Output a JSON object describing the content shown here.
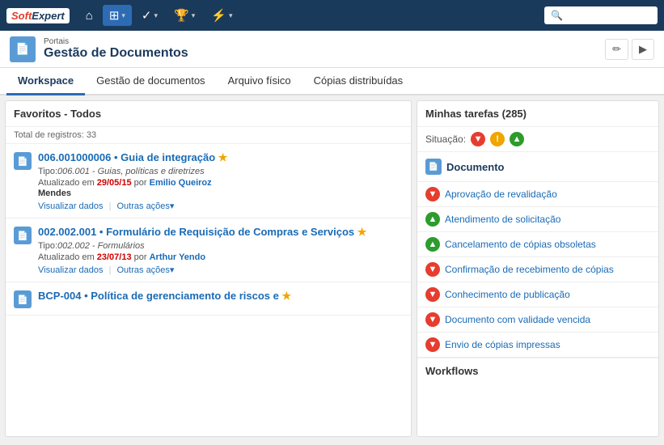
{
  "navbar": {
    "logo_soft": "Soft",
    "logo_expert": "Expert",
    "nav_items": [
      {
        "id": "home",
        "icon": "⌂",
        "label": "Home",
        "active": false
      },
      {
        "id": "apps",
        "icon": "⊞",
        "label": "Apps",
        "active": true,
        "has_chevron": true
      },
      {
        "id": "check",
        "icon": "✓",
        "label": "Check",
        "active": false,
        "has_chevron": true
      },
      {
        "id": "trophy",
        "icon": "🏆",
        "label": "Trophy",
        "active": false,
        "has_chevron": true
      },
      {
        "id": "lightning",
        "icon": "⚡",
        "label": "Lightning",
        "active": false,
        "has_chevron": true
      }
    ],
    "search_placeholder": "🔍"
  },
  "page_header": {
    "portais_label": "Portais",
    "title": "Gestão de Documentos"
  },
  "tabs": [
    {
      "id": "workspace",
      "label": "Workspace",
      "active": true
    },
    {
      "id": "gestao",
      "label": "Gestão de documentos",
      "active": false
    },
    {
      "id": "arquivo",
      "label": "Arquivo físico",
      "active": false
    },
    {
      "id": "copias",
      "label": "Cópias distribuídas",
      "active": false
    }
  ],
  "left_panel": {
    "header": "Favoritos - Todos",
    "total_label": "Total de registros: 33",
    "documents": [
      {
        "id": "doc1",
        "code": "006.001000006 • Guia de integração ★",
        "title_text": "006.001000006 • Guia de integração",
        "has_star": true,
        "type_prefix": "Tipo:",
        "type_code": "006.001",
        "type_name": "Guias, políticas e diretrizes",
        "updated_prefix": "Atualizado em ",
        "updated_date": "29/05/15",
        "updated_by": " por ",
        "author1": "Emilio Queiroz",
        "author2": "Mendes",
        "view_label": "Visualizar dados",
        "actions_label": "Outras ações▾"
      },
      {
        "id": "doc2",
        "code": "002.002.001 • Formulário de Requisição de Compras e Serviços ★",
        "title_text": "002.002.001 • Formulário de Requisição de Compras e Serviços",
        "has_star": true,
        "type_prefix": "Tipo:",
        "type_code": "002.002",
        "type_name": "Formulários",
        "updated_prefix": "Atualizado em ",
        "updated_date": "23/07/13",
        "updated_by": " por ",
        "author1": "Arthur Yendo",
        "author2": "",
        "view_label": "Visualizar dados",
        "actions_label": "Outras ações▾"
      },
      {
        "id": "doc3",
        "code": "BCP-004 • Política de gerenciamento de riscos e...",
        "title_text": "BCP-004 • Política de gerenciamento de riscos e",
        "has_star": true,
        "type_prefix": "",
        "type_code": "",
        "type_name": "",
        "updated_prefix": "",
        "updated_date": "",
        "updated_by": "",
        "author1": "",
        "author2": "",
        "view_label": "",
        "actions_label": ""
      }
    ]
  },
  "right_panel": {
    "header": "Minhas tarefas (285)",
    "situacao_label": "Situação:",
    "task_section_title": "Documento",
    "tasks": [
      {
        "id": "t1",
        "status": "red",
        "label": "Aprovação de revalidação"
      },
      {
        "id": "t2",
        "status": "green",
        "label": "Atendimento de solicitação"
      },
      {
        "id": "t3",
        "status": "green",
        "label": "Cancelamento de cópias obsoletas"
      },
      {
        "id": "t4",
        "status": "red",
        "label": "Confirmação de recebimento de cópias"
      },
      {
        "id": "t5",
        "status": "red",
        "label": "Conhecimento de publicação"
      },
      {
        "id": "t6",
        "status": "red",
        "label": "Documento com validade vencida"
      },
      {
        "id": "t7",
        "status": "red",
        "label": "Envio de cópias impressas"
      }
    ],
    "workflows_header": "Workflows"
  }
}
